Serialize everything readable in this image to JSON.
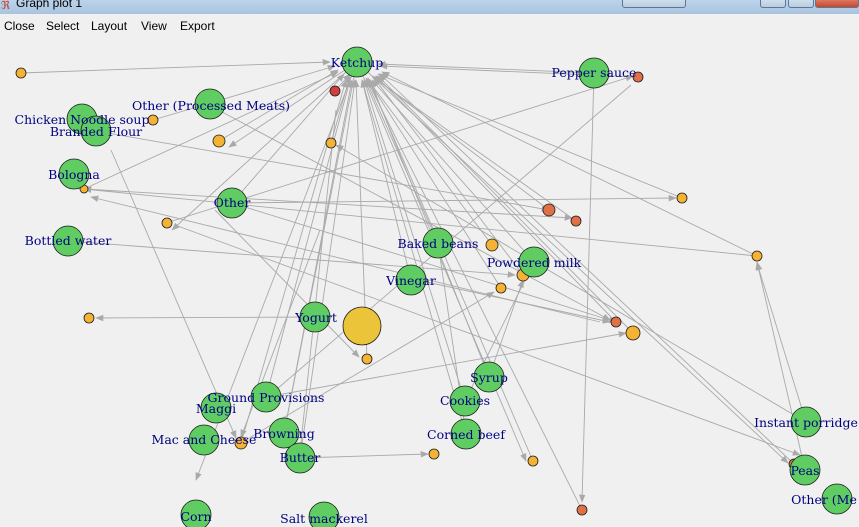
{
  "window": {
    "title": "Graph plot 1",
    "icon": "r-logo-icon"
  },
  "menu": [
    "Close",
    "Select",
    "Layout",
    "View",
    "Export"
  ],
  "colors": {
    "green_node": "#5fcd62",
    "orange_node": "#f5b335",
    "red_node": "#e07048",
    "dark_red_node": "#d04040",
    "big_node": "#ecc43a",
    "edge": "#a9a9a9",
    "label": "#000080"
  },
  "graph": {
    "labels": [
      "Ketchup",
      "Pepper sauce",
      "Other (Processed Meats)",
      "Chicken Noodle soup",
      "Branded Flour",
      "Bologna",
      "Other",
      "Bottled water",
      "Baked beans",
      "Powdered milk",
      "Vinegar",
      "Yogurt",
      "Ground Provisions",
      "Maggi",
      "Mac and Cheese",
      "Browning",
      "Butter",
      "Syrup",
      "Cookies",
      "Corned beef",
      "Instant porridge",
      "Peas",
      "Other (Me",
      "Corn",
      "Salt mackerel"
    ]
  }
}
